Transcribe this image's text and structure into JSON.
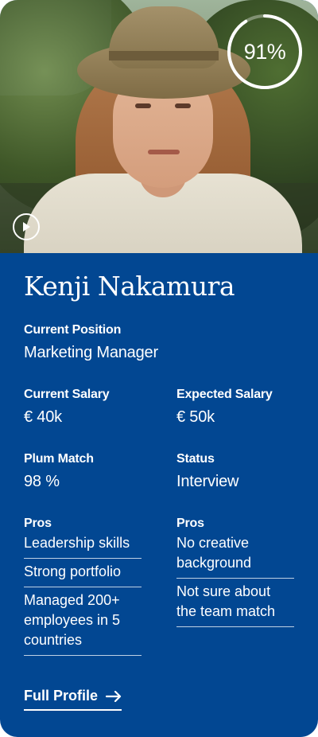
{
  "candidate": {
    "name": "Kenji Nakamura",
    "match_score": "91%",
    "current_position_label": "Current Position",
    "current_position": "Marketing Manager",
    "current_salary_label": "Current Salary",
    "current_salary": "€ 40k",
    "expected_salary_label": "Expected Salary",
    "expected_salary": "€ 50k",
    "plum_match_label": "Plum Match",
    "plum_match": "98 %",
    "status_label": "Status",
    "status": "Interview",
    "pros_label": "Pros",
    "pros": [
      "Leadership skills",
      "Strong portfolio",
      "Managed 200+ employees in 5 countries"
    ],
    "cons_label": "Pros",
    "cons": [
      "No creative background",
      "Not sure about the team match"
    ]
  },
  "actions": {
    "full_profile_label": "Full Profile",
    "full_profile_icon": "arrow-right-icon",
    "play_icon": "play-icon"
  },
  "colors": {
    "panel_bg": "#024792",
    "text": "#ffffff"
  }
}
